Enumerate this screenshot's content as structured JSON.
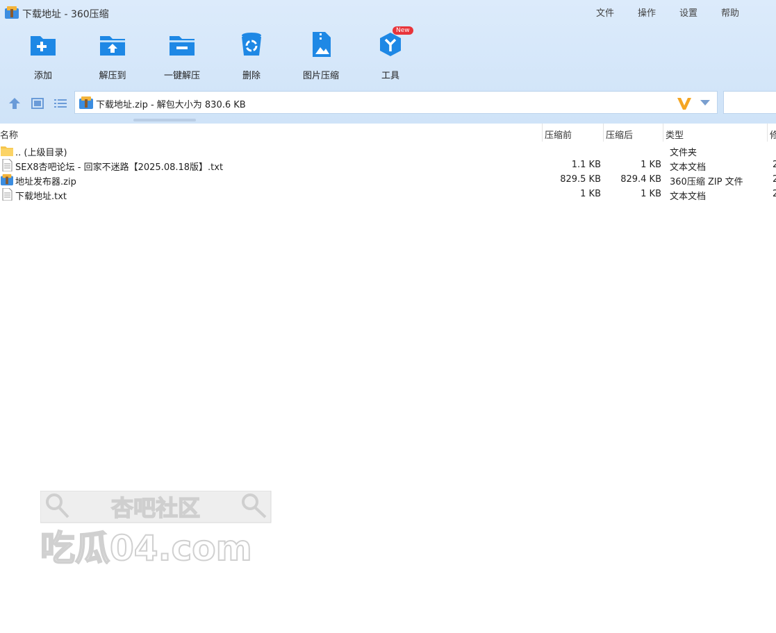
{
  "window": {
    "title": "下载地址 - 360压缩"
  },
  "menu": [
    "文件",
    "操作",
    "设置",
    "帮助"
  ],
  "toolbar": [
    {
      "label": "添加",
      "icon": "add-folder-icon"
    },
    {
      "label": "解压到",
      "icon": "extract-to-icon"
    },
    {
      "label": "一键解压",
      "icon": "one-click-extract-icon"
    },
    {
      "label": "删除",
      "icon": "trash-icon"
    },
    {
      "label": "图片压缩",
      "icon": "image-compress-icon"
    },
    {
      "label": "工具",
      "icon": "tools-icon",
      "badge": "New"
    }
  ],
  "address": {
    "text": "下载地址.zip - 解包大小为 830.6 KB"
  },
  "columns": {
    "name": "名称",
    "before": "压缩前",
    "after": "压缩后",
    "type": "类型",
    "modified": "修"
  },
  "rows": [
    {
      "name": ".. (上级目录)",
      "before": "",
      "after": "",
      "type": "文件夹",
      "mod": "",
      "icon": "folder-icon"
    },
    {
      "name": "SEX8杏吧论坛 - 回家不迷路【2025.08.18版】.txt",
      "before": "1.1 KB",
      "after": "1 KB",
      "type": "文本文档",
      "mod": "2",
      "icon": "text-file-icon"
    },
    {
      "name": "地址发布器.zip",
      "before": "829.5 KB",
      "after": "829.4 KB",
      "type": "360压缩 ZIP 文件",
      "mod": "2",
      "icon": "zip-file-icon"
    },
    {
      "name": "下载地址.txt",
      "before": "1 KB",
      "after": "1 KB",
      "type": "文本文档",
      "mod": "2",
      "icon": "text-file-icon"
    }
  ],
  "watermark": {
    "line1": "杏吧社区",
    "line2": "吃瓜04.com"
  },
  "colors": {
    "toolbar_bg": "#d6e8fa",
    "icon_blue": "#1e88e5",
    "badge_red": "#e8343a",
    "v_logo": "#f5a623"
  }
}
